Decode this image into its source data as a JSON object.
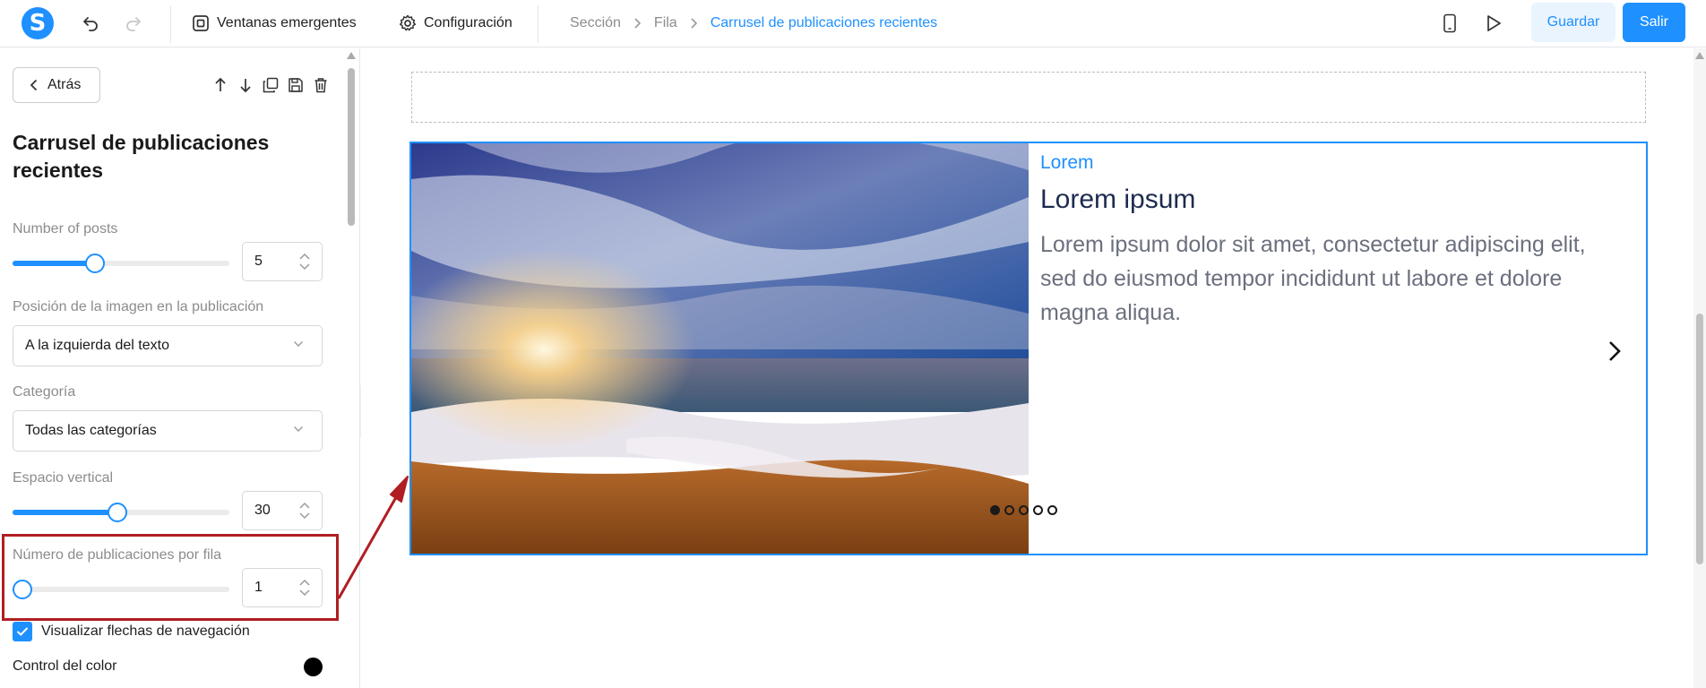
{
  "app": {
    "logo_letter": "S",
    "brand_color": "#1e90ff"
  },
  "topbar": {
    "popups_label": "Ventanas emergentes",
    "settings_label": "Configuración",
    "breadcrumb": [
      "Sección",
      "Fila",
      "Carrusel de publicaciones recientes"
    ],
    "save_label": "Guardar",
    "exit_label": "Salir"
  },
  "sidebar": {
    "back_label": "Atrás",
    "title": "Carrusel de publicaciones recientes",
    "fields": {
      "number_of_posts": {
        "label": "Number of posts",
        "value": "5",
        "slider_fraction": 0.37
      },
      "image_position": {
        "label": "Posición de la imagen en la publicación",
        "value": "A la izquierda del texto"
      },
      "category": {
        "label": "Categoría",
        "value": "Todas las categorías"
      },
      "vertical_space": {
        "label": "Espacio vertical",
        "value": "30",
        "slider_fraction": 0.48
      },
      "posts_per_row": {
        "label": "Número de publicaciones por fila",
        "value": "1",
        "slider_fraction": 0.0
      },
      "show_arrows": {
        "label": "Visualizar flechas de navegación",
        "checked": true
      },
      "color_control": {
        "label": "Control del color",
        "color": "#000000"
      }
    }
  },
  "post": {
    "category": "Lorem",
    "title": "Lorem ipsum",
    "excerpt": "Lorem ipsum dolor sit amet, consectetur adipiscing elit, sed do eiusmod tempor incididunt ut labore et dolore magna aliqua.",
    "dots_total": 5,
    "dots_active": 1
  },
  "annotation_color": "#b01e23"
}
